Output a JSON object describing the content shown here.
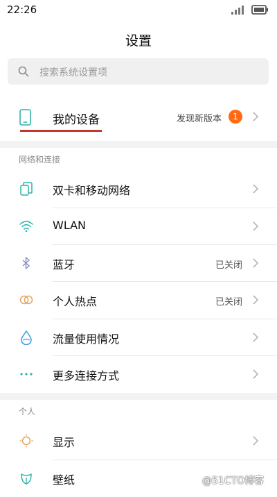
{
  "status_bar": {
    "time": "22:26"
  },
  "header": {
    "title": "设置"
  },
  "search": {
    "placeholder": "搜索系统设置项"
  },
  "my_device": {
    "label": "我的设备",
    "update_text": "发现新版本",
    "badge_count": "1"
  },
  "sections": [
    {
      "header": "网络和连接",
      "items": [
        {
          "label": "双卡和移动网络",
          "status": "",
          "icon": "dual-sim-icon"
        },
        {
          "label": "WLAN",
          "status": "",
          "icon": "wifi-icon"
        },
        {
          "label": "蓝牙",
          "status": "已关闭",
          "icon": "bluetooth-icon"
        },
        {
          "label": "个人热点",
          "status": "已关闭",
          "icon": "hotspot-icon"
        },
        {
          "label": "流量使用情况",
          "status": "",
          "icon": "data-usage-icon"
        },
        {
          "label": "更多连接方式",
          "status": "",
          "icon": "more-connections-icon"
        }
      ]
    },
    {
      "header": "个人",
      "items": [
        {
          "label": "显示",
          "status": "",
          "icon": "display-icon"
        },
        {
          "label": "壁纸",
          "status": "",
          "icon": "wallpaper-icon"
        }
      ]
    }
  ],
  "watermark": "@51CTO博客",
  "colors": {
    "accent_underline": "#c0392b",
    "badge": "#ff6a14",
    "icon_teal": "#2bb3a8",
    "icon_orange": "#e6a25c"
  }
}
